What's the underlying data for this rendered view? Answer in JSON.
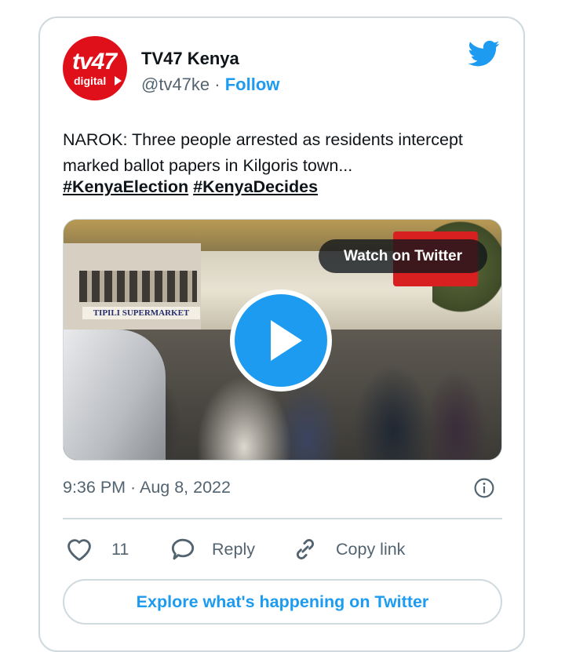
{
  "author": {
    "name": "TV47 Kenya",
    "handle": "@tv47ke",
    "separator": "·",
    "follow_label": "Follow",
    "avatar_text_top": "tv47",
    "avatar_text_bottom": "digital"
  },
  "tweet": {
    "text": "NAROK: Three people arrested as residents intercept marked ballot papers in Kilgoris town...",
    "hashtags": [
      "#KenyaElection",
      "#KenyaDecides"
    ]
  },
  "media": {
    "watch_label": "Watch on Twitter",
    "sign_text": "TIPILI SUPERMARKET"
  },
  "meta": {
    "timestamp": "9:36 PM · Aug 8, 2022"
  },
  "actions": {
    "like_count": "11",
    "reply_label": "Reply",
    "copy_label": "Copy link"
  },
  "footer": {
    "explore_label": "Explore what's happening on Twitter"
  },
  "colors": {
    "accent": "#1d9bf0",
    "text": "#0f1419",
    "secondary": "#536471",
    "border": "#cfd9de",
    "avatar_bg": "#e0101a"
  },
  "icons": [
    "twitter-bird-icon",
    "play-icon",
    "info-icon",
    "heart-icon",
    "reply-bubble-icon",
    "link-icon"
  ]
}
